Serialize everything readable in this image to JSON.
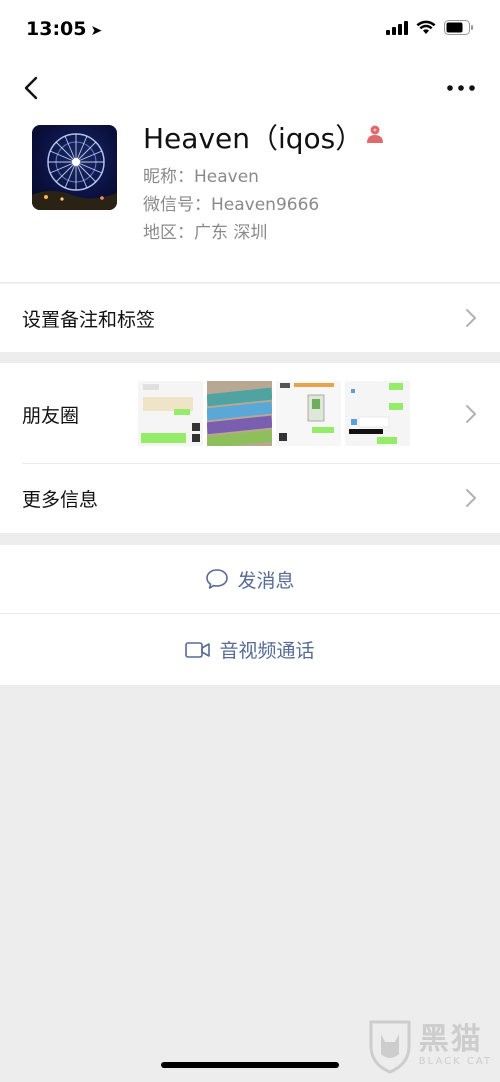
{
  "status": {
    "time": "13:05"
  },
  "profile": {
    "display_name": "Heaven（iqos）",
    "nickname": "昵称：Heaven",
    "wechat_id": "微信号：Heaven9666",
    "region": "地区：广东 深圳"
  },
  "rows": {
    "remark_tags": "设置备注和标签",
    "moments": "朋友圈",
    "more_info": "更多信息"
  },
  "actions": {
    "message": "发消息",
    "call": "音视频通话"
  },
  "watermark": {
    "title": "黑猫",
    "subtitle": "BLACK CAT"
  },
  "colors": {
    "link": "#576b95",
    "background": "#ededed",
    "gender_icon": "#e06a6a"
  },
  "icons": [
    "location-arrow-icon",
    "signal-icon",
    "wifi-icon",
    "battery-icon",
    "back-icon",
    "more-icon",
    "female-icon",
    "chevron-right-icon",
    "chat-bubble-icon",
    "video-camera-icon"
  ]
}
